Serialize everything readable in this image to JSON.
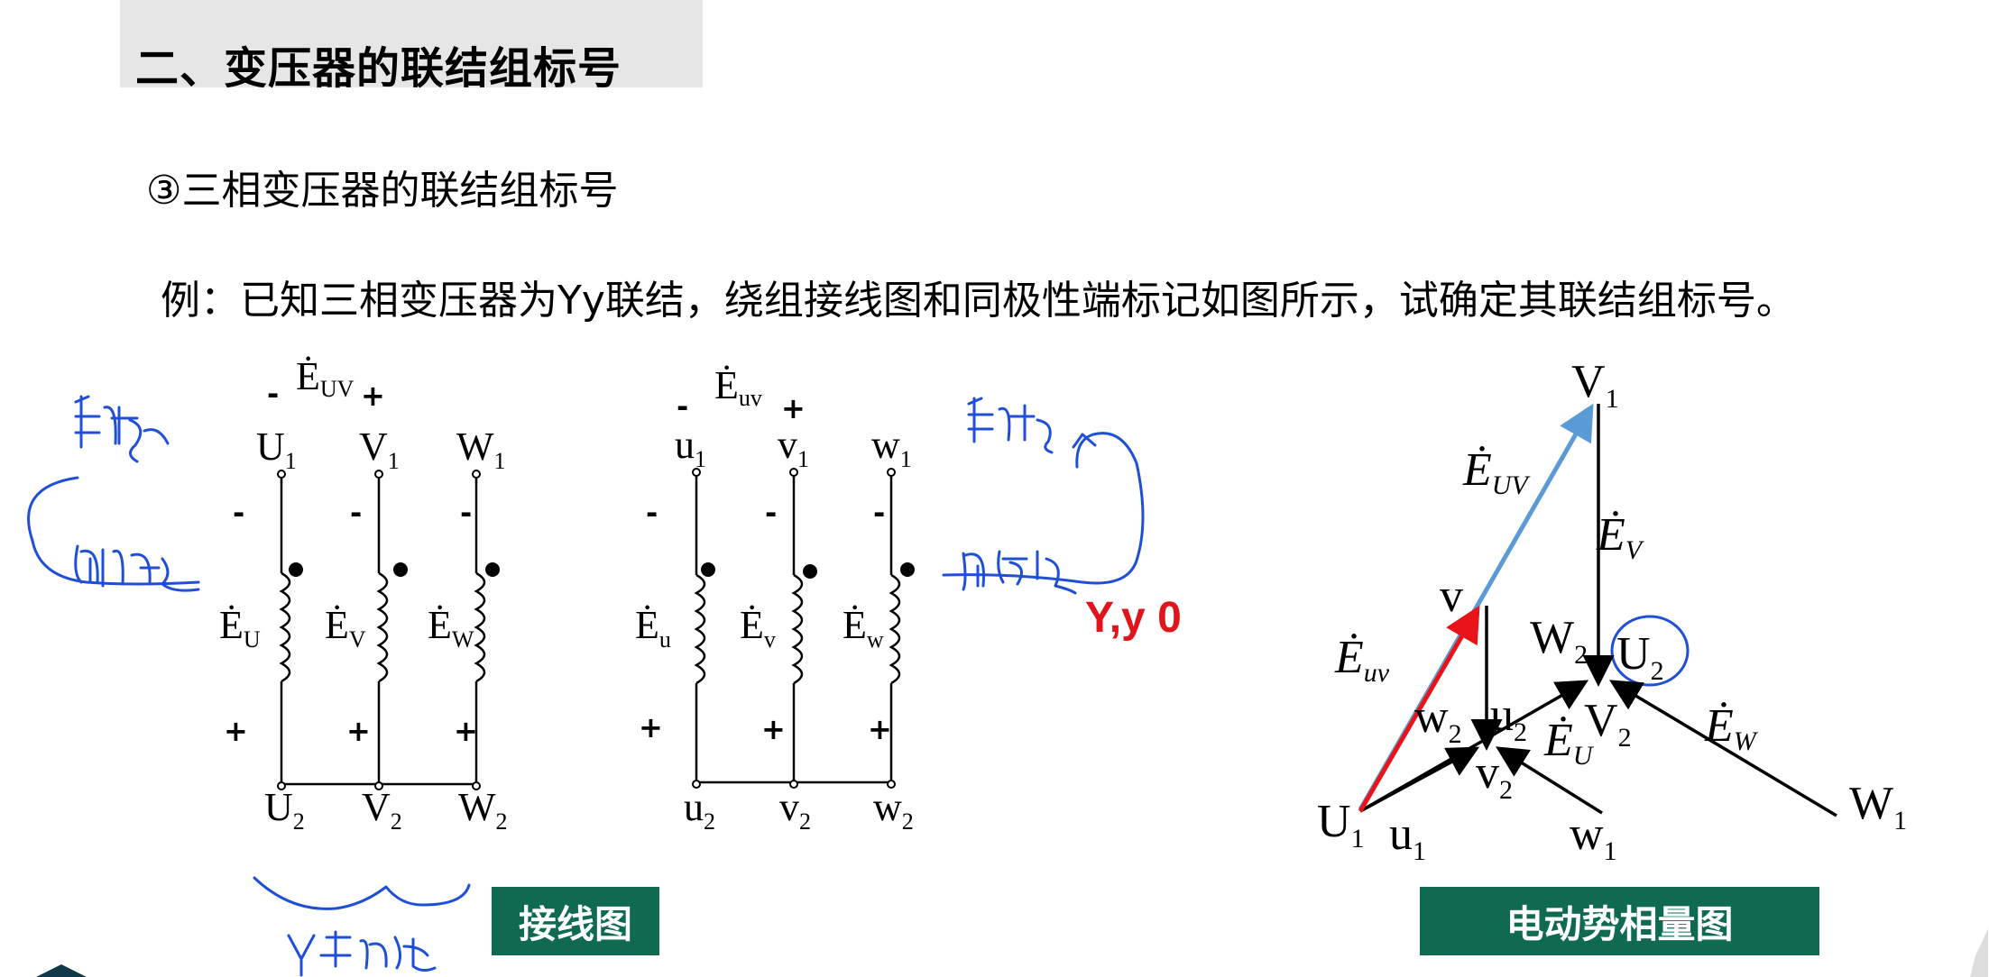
{
  "header": {
    "title": "二、变压器的联结组标号"
  },
  "subtitle": "③三相变压器的联结组标号",
  "example": "例：已知三相变压器为Yy联结，绕组接线图和同极性端标记如图所示，试确定其联结组标号。",
  "wiring_diagram": {
    "primary": {
      "emf_label": "Ė",
      "emf_sub": "UV",
      "emf_minus": "-",
      "emf_plus": "+",
      "top_terminals": [
        {
          "main": "U",
          "sub": "1"
        },
        {
          "main": "V",
          "sub": "1"
        },
        {
          "main": "W",
          "sub": "1"
        }
      ],
      "bottom_terminals": [
        {
          "main": "U",
          "sub": "2"
        },
        {
          "main": "V",
          "sub": "2"
        },
        {
          "main": "W",
          "sub": "2"
        }
      ],
      "winding_emfs": [
        {
          "main": "Ė",
          "sub": "U"
        },
        {
          "main": "Ė",
          "sub": "V"
        },
        {
          "main": "Ė",
          "sub": "W"
        }
      ]
    },
    "secondary": {
      "emf_label": "Ė",
      "emf_sub": "uv",
      "emf_minus": "-",
      "emf_plus": "+",
      "top_terminals": [
        {
          "main": "u",
          "sub": "1"
        },
        {
          "main": "v",
          "sub": "1"
        },
        {
          "main": "w",
          "sub": "1"
        }
      ],
      "bottom_terminals": [
        {
          "main": "u",
          "sub": "2"
        },
        {
          "main": "v",
          "sub": "2"
        },
        {
          "main": "w",
          "sub": "2"
        }
      ],
      "winding_emfs": [
        {
          "main": "Ė",
          "sub": "u"
        },
        {
          "main": "Ė",
          "sub": "v"
        },
        {
          "main": "Ė",
          "sub": "w"
        }
      ]
    },
    "minus_sign": "-",
    "plus_sign": "+",
    "result_label": "Y,y 0",
    "badge": "接线图"
  },
  "phasor_diagram": {
    "badge": "电动势相量图",
    "labels": {
      "V1": {
        "main": "V",
        "sub": "1"
      },
      "U1": {
        "main": "U",
        "sub": "1"
      },
      "W1": {
        "main": "W",
        "sub": "1"
      },
      "W2": {
        "main": "W",
        "sub": "2"
      },
      "U2": {
        "main": "U",
        "sub": "2"
      },
      "V2": {
        "main": "V",
        "sub": "2"
      },
      "v1": {
        "main": "v",
        "sub": ""
      },
      "u1": {
        "main": "u",
        "sub": "1"
      },
      "w1": {
        "main": "w",
        "sub": "1"
      },
      "w2": {
        "main": "w",
        "sub": "2"
      },
      "u2": {
        "main": "u",
        "sub": "2"
      },
      "v2": {
        "main": "v",
        "sub": "2"
      },
      "E_UV": {
        "main": "Ė",
        "sub": "UV"
      },
      "E_V": {
        "main": "Ė",
        "sub": "V"
      },
      "E_U": {
        "main": "Ė",
        "sub": "U"
      },
      "E_W": {
        "main": "Ė",
        "sub": "W"
      },
      "E_uv": {
        "main": "Ė",
        "sub": "uv"
      }
    },
    "colors": {
      "primary_phasor": "#5b9bd5",
      "secondary_phasor": "#e8141a",
      "annotation_ink": "#1f4fd6",
      "badge_bg": "#0f6a50"
    }
  },
  "icons": [
    "logo-corner-icon"
  ]
}
